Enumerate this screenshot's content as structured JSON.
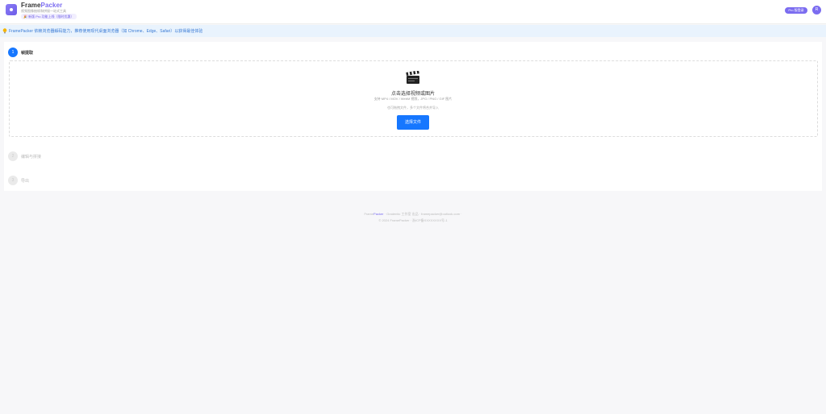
{
  "header": {
    "brand_main": "Frame",
    "brand_accent": "Packer",
    "subtitle": "视频图像抽帧和拼接一站式工具",
    "promo": "🎉 新版 Pro 功能上线（限时优惠）",
    "pro_button": "Pro 版登录",
    "avatar_initial": "R"
  },
  "notice": {
    "icon": "lightbulb-icon",
    "text": "FramePacker 依赖浏览器解码能力，推荐使用现代桌面浏览器（如 Chrome、Edge、Safari）以获得最佳体验"
  },
  "steps": [
    {
      "number": "1",
      "title": "帧提取",
      "state": "active"
    },
    {
      "number": "2",
      "title": "编辑与拼接",
      "state": "inactive"
    },
    {
      "number": "3",
      "title": "导出",
      "state": "inactive"
    }
  ],
  "upload": {
    "icon": "clapperboard-icon",
    "title": "点击选择视频或图片",
    "formats": "支持 MP4 / MOV / WebM 视频，JPG / PNG / GIF 图片",
    "hint": "也可拖拽文件，多个文件将合并导入",
    "button": "选择文件"
  },
  "footer": {
    "brand_main": "Frame",
    "brand_accent": "Packer",
    "line1_rest": "· Gradentic 工作室 出品 · framepacker@outlook.com ·",
    "line2": "© 2024 FramePacker · 浙ICP备XXXXXXXX号-1"
  },
  "colors": {
    "primary": "#1677ff",
    "brand": "#7b6cf0",
    "notice_bg": "#e9f3fd"
  }
}
